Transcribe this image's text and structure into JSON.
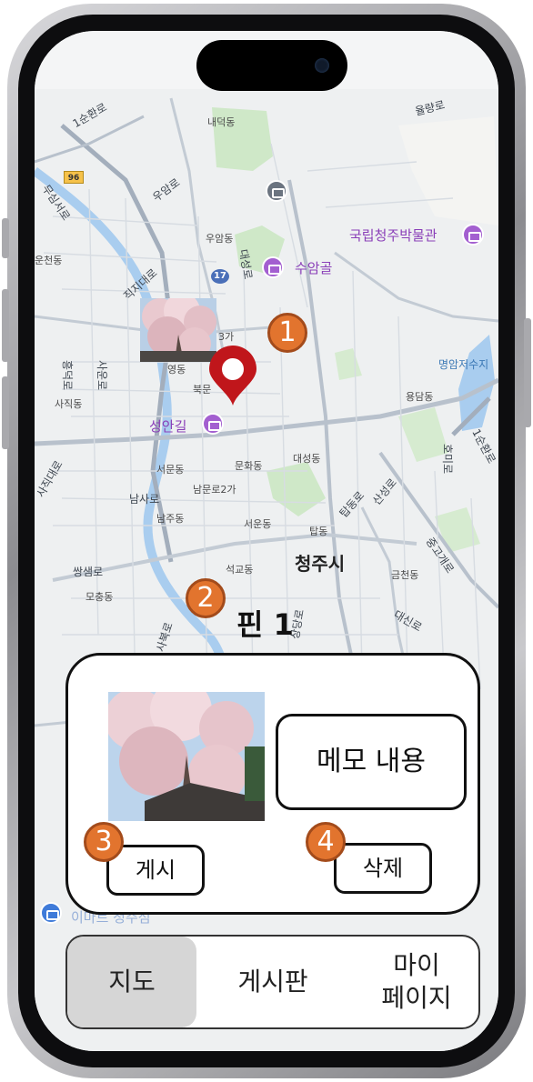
{
  "map": {
    "road_labels": [
      "1순환로",
      "율량로",
      "우암로",
      "무심서로",
      "직지대로",
      "대성로",
      "사운로",
      "흥덕로",
      "사직대로",
      "남사로",
      "쌍샘로",
      "탑동로",
      "산성로",
      "호미로",
      "1순환로",
      "중고개로",
      "상당로",
      "사북로",
      "대신로"
    ],
    "district_labels": [
      "내덕동",
      "우암동",
      "운천동",
      "3가",
      "영동",
      "북문",
      "사직동",
      "서문동",
      "문화동",
      "남문로2가",
      "남주동",
      "서운동",
      "탑동",
      "석교동",
      "모충동",
      "금천동",
      "대성동",
      "용담동"
    ],
    "city_label": "청주시",
    "poi_labels": {
      "museum": "국립청주박물관",
      "suamgol": "수암골",
      "seongangil": "성안길",
      "mart": "이마트 청주점",
      "reservoir": "명암저수지"
    },
    "road_numbers": [
      "96",
      "17"
    ],
    "pin_color": "#c0161b"
  },
  "badges": [
    "1",
    "2",
    "3",
    "4"
  ],
  "pin_title": "핀 1",
  "card": {
    "memo": "메모 내용",
    "post_button": "게시",
    "delete_button": "삭제"
  },
  "nav": {
    "tabs": [
      "지도",
      "게시판",
      "마이\n페이지"
    ],
    "active": 0
  },
  "colors": {
    "badge": "#e2742e",
    "poi": "#8a3fb8",
    "nav_active": "#d6d6d6"
  }
}
